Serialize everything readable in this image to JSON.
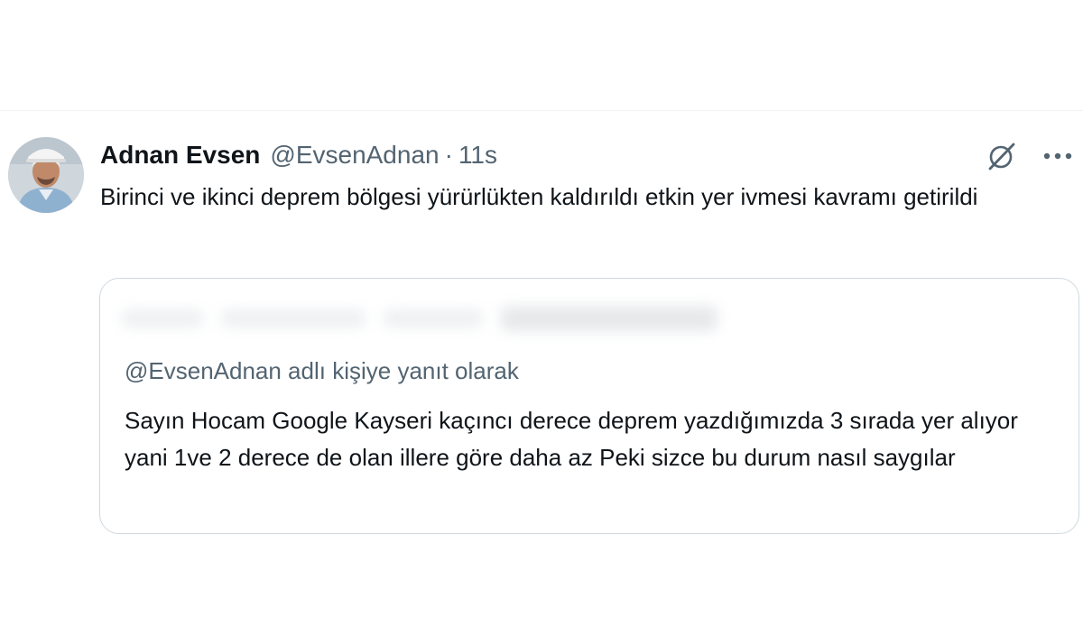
{
  "tweet": {
    "author_name": "Adnan Evsen",
    "handle": "@EvsenAdnan",
    "separator": "·",
    "time": "11s",
    "text": "Birinci ve ikinci deprem bölgesi yürürlükten kaldırıldı etkin yer ivmesi kavramı getirildi",
    "icons": [
      "grok-icon",
      "more-options-icon"
    ]
  },
  "quote": {
    "reply_to": "@EvsenAdnan adlı kişiye yanıt olarak",
    "text": "Sayın Hocam Google Kayseri kaçıncı derece deprem yazdığımızda 3 sırada yer alıyor yani 1ve 2 derece de olan illere göre daha az Peki sizce bu durum nasıl saygılar"
  },
  "colors": {
    "primary_text": "#0f1419",
    "secondary_text": "#536471",
    "border": "#cfd9de",
    "divider": "#eff3f4"
  }
}
